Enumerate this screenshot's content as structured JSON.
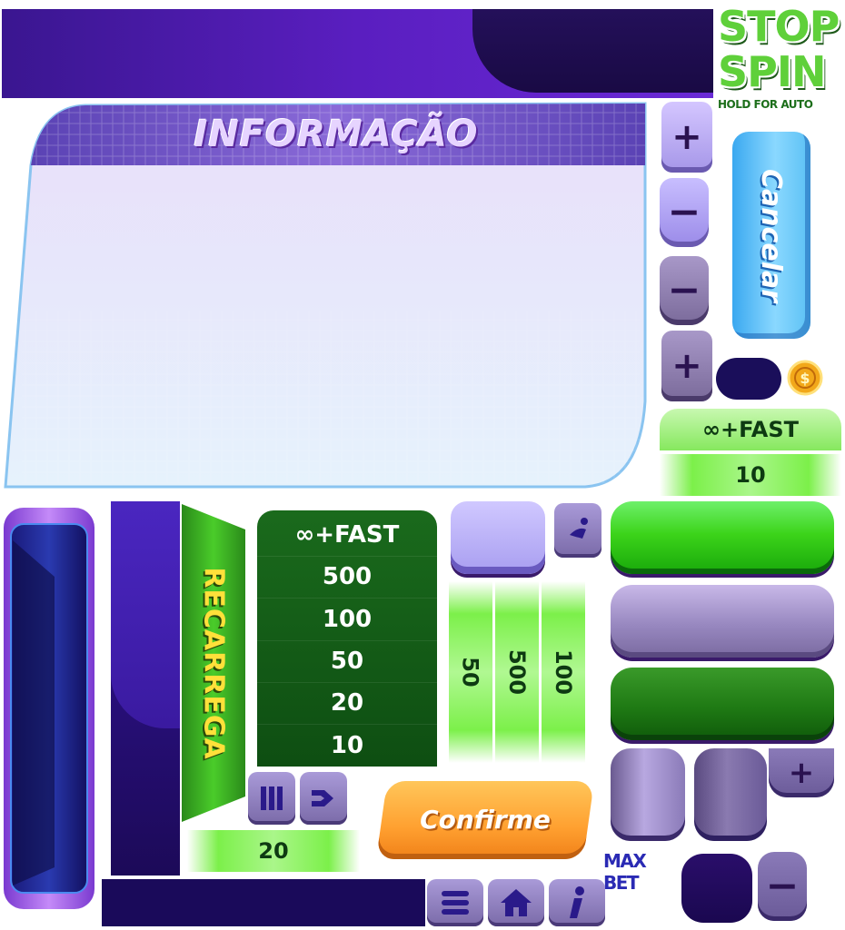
{
  "stop_spin": {
    "line1": "STOP",
    "line2": "SPIN",
    "subtitle": "HOLD FOR AUTO"
  },
  "info_panel": {
    "title": "INFORMAÇÃO"
  },
  "controls": {
    "plus": "+",
    "minus": "−",
    "cancel_label": "Cancelar"
  },
  "right_strip": {
    "fast_label": "∞+FAST",
    "value": "10"
  },
  "recharge": {
    "label": "RECARREGA"
  },
  "auto_list": {
    "items": [
      "∞+FAST",
      "500",
      "100",
      "50",
      "20",
      "10"
    ]
  },
  "vertical_strips": [
    "50",
    "500",
    "100"
  ],
  "bottom_value": "20",
  "confirm_label": "Confirme",
  "max_bet_label": "MAX BET",
  "colors": {
    "purple_dark": "#190a44",
    "purple_banner": "#5a1ec0",
    "green_bright": "#3cd41a",
    "green_dark": "#1f7a14",
    "orange": "#ffa030",
    "cyan": "#5ac0f4"
  }
}
